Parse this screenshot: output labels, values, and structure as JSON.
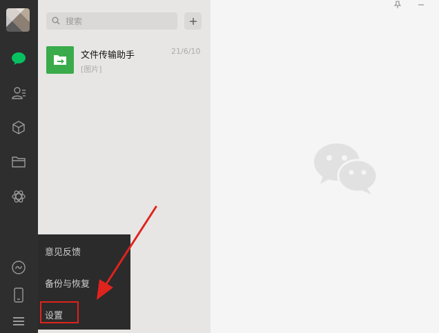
{
  "sidebar": {
    "icons": [
      "chat-bubble-icon",
      "contacts-icon",
      "cube-icon",
      "folder-icon",
      "moments-icon",
      "mini-program-icon",
      "phone-icon",
      "menu-icon"
    ]
  },
  "search": {
    "placeholder": "搜索"
  },
  "chat_list": [
    {
      "name": "文件传输助手",
      "time": "21/6/10",
      "preview": "[图片]"
    }
  ],
  "popup_menu": {
    "items": [
      "意见反馈",
      "备份与恢复",
      "设置"
    ]
  },
  "colors": {
    "sidebar_bg": "#2e2e2e",
    "accent_green": "#07c160",
    "file_helper_green": "#3aab4a",
    "annotation_red": "#e0231d"
  }
}
